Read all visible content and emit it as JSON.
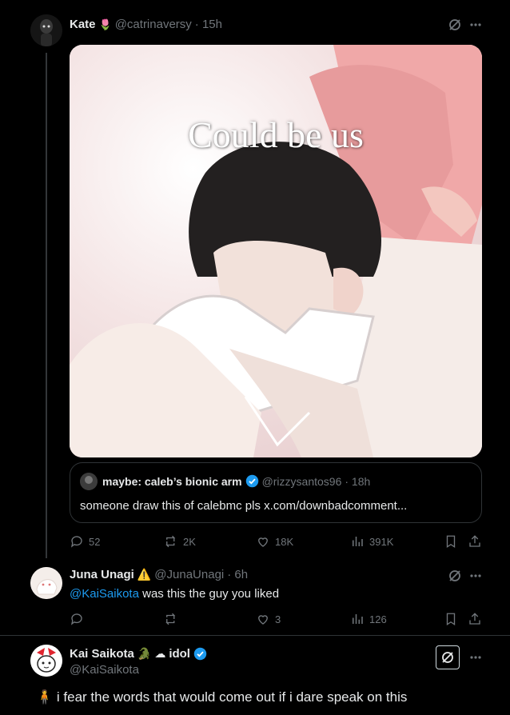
{
  "tweet1": {
    "author_name": "Kate",
    "author_emoji": "🌷",
    "handle": "@catrinaversy",
    "time": "· 15h",
    "image_caption": "Could be us",
    "quote": {
      "author_name": "maybe: caleb’s bionic arm",
      "handle": "@rizzysantos96",
      "time": "· 18h",
      "text": "someone draw this of calebmc pls x.com/downbadcomment..."
    },
    "stats": {
      "replies": "52",
      "reposts": "2K",
      "likes": "18K",
      "views": "391K"
    }
  },
  "tweet2": {
    "author_name": "Juna Unagi",
    "author_emoji": "⚠️",
    "handle": "@JunaUnagi",
    "time": "· 6h",
    "mention": "@KaiSaikota",
    "text": " was this the guy you liked",
    "stats": {
      "replies": "",
      "reposts": "",
      "likes": "3",
      "views": "126"
    }
  },
  "tweet3": {
    "author_name": "Kai Saikota",
    "name_suffix_text": "idol",
    "handle": "@KaiSaikota",
    "emoji_prefix": "🧍",
    "text": "i fear the words that would come out if i dare speak on this"
  },
  "colors": {
    "accent": "#1d9bf0",
    "muted": "#71767b",
    "border": "#2f3336",
    "bg": "#000000"
  }
}
